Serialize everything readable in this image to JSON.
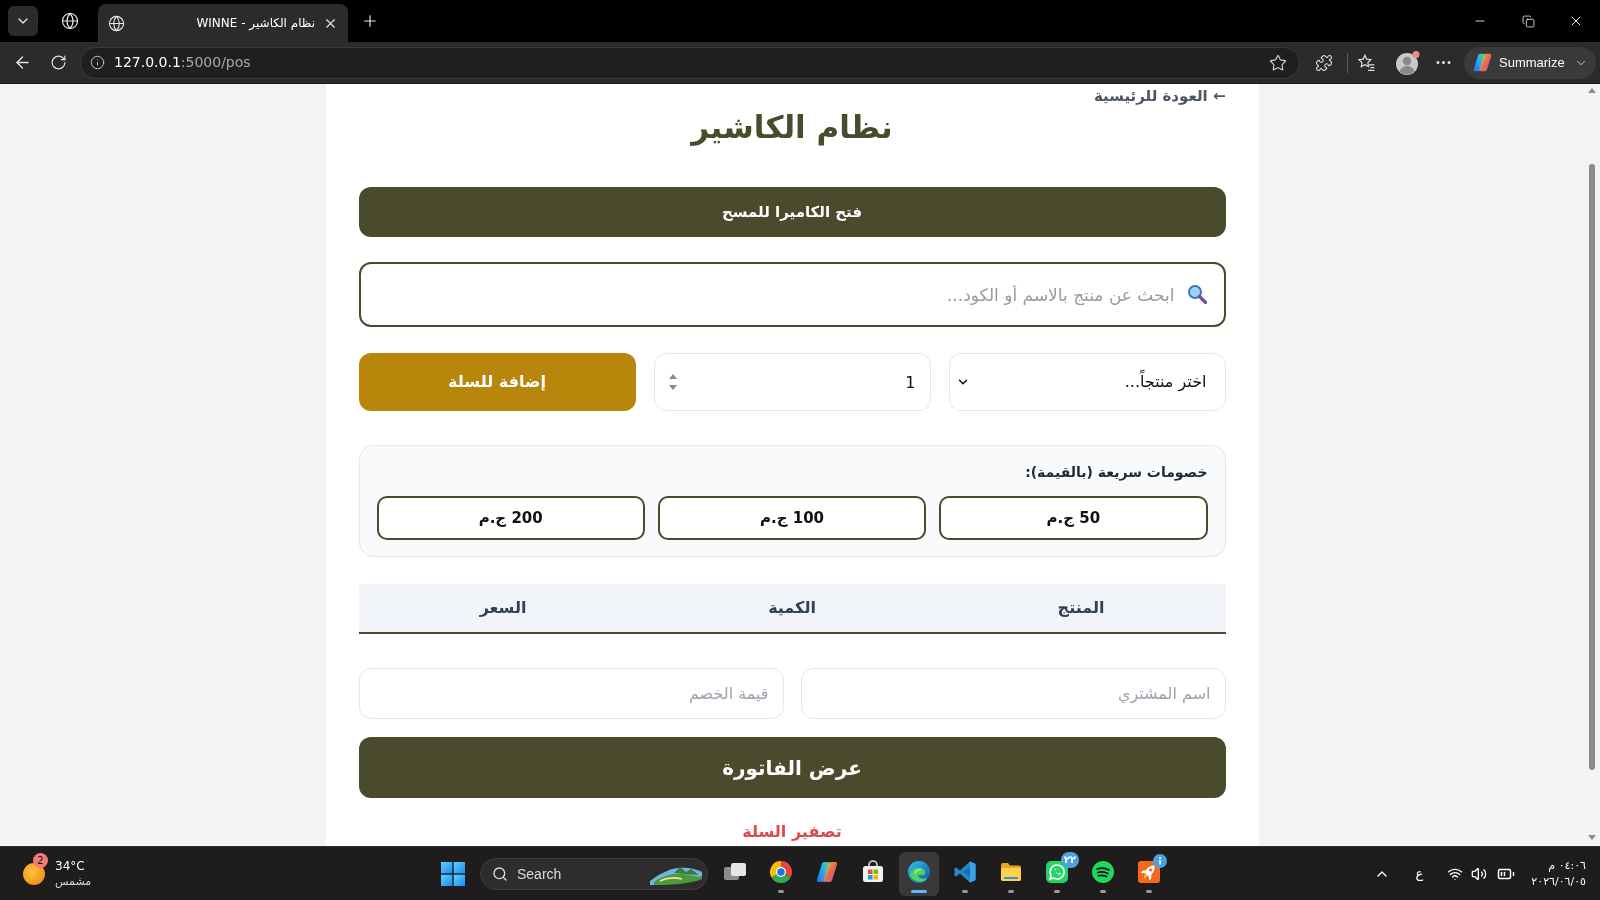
{
  "browser": {
    "tabs": [
      {
        "title": "نظام الكاشير - WINNE",
        "selected": true
      }
    ],
    "address": {
      "host": "127.0.0.1",
      "path": ":5000/pos"
    },
    "summarize_button": "Summarize"
  },
  "page": {
    "back_link": "← العودة للرئيسية",
    "title": "نظام الكاشير",
    "camera_button": "فتح الكاميرا للمسح",
    "search": {
      "placeholder": "ابحث عن منتج بالاسم أو الكود..."
    },
    "product_select": {
      "value": "اختر منتجاً..."
    },
    "quantity": {
      "value": "1"
    },
    "add_to_cart_button": "إضافة للسلة",
    "quick_discounts": {
      "label": "خصومات سريعة (بالقيمة):",
      "buttons": [
        "50 ج.م",
        "100 ج.م",
        "200 ج.م"
      ]
    },
    "cart_table": {
      "columns": [
        "المنتج",
        "الكمية",
        "السعر"
      ]
    },
    "buyer_name": {
      "placeholder": "اسم المشتري"
    },
    "discount_value": {
      "placeholder": "قيمة الخصم"
    },
    "invoice_button": "عرض الفاتورة",
    "clear_cart_link": "تصفير السلة"
  },
  "taskbar": {
    "weather": {
      "badge": "2",
      "temperature": "34°C",
      "condition": "مشمس"
    },
    "search": {
      "placeholder": "Search"
    },
    "apps": [
      {
        "kind": "task-view",
        "running": false,
        "active": false
      },
      {
        "kind": "chrome",
        "running": true,
        "active": false
      },
      {
        "kind": "copilot",
        "running": false,
        "active": false
      },
      {
        "kind": "store",
        "running": false,
        "active": false
      },
      {
        "kind": "edge",
        "running": true,
        "active": true
      },
      {
        "kind": "vscode",
        "running": true,
        "active": false
      },
      {
        "kind": "explorer",
        "running": true,
        "active": false
      },
      {
        "kind": "whatsapp",
        "running": true,
        "active": false,
        "badge": "٢٢"
      },
      {
        "kind": "spotify",
        "running": true,
        "active": false
      },
      {
        "kind": "rocket",
        "running": true,
        "active": false
      }
    ],
    "language": "ع",
    "time": "٠٤:٠٦ م",
    "date": "٢٠٢٦/٠٦/٠٥"
  }
}
